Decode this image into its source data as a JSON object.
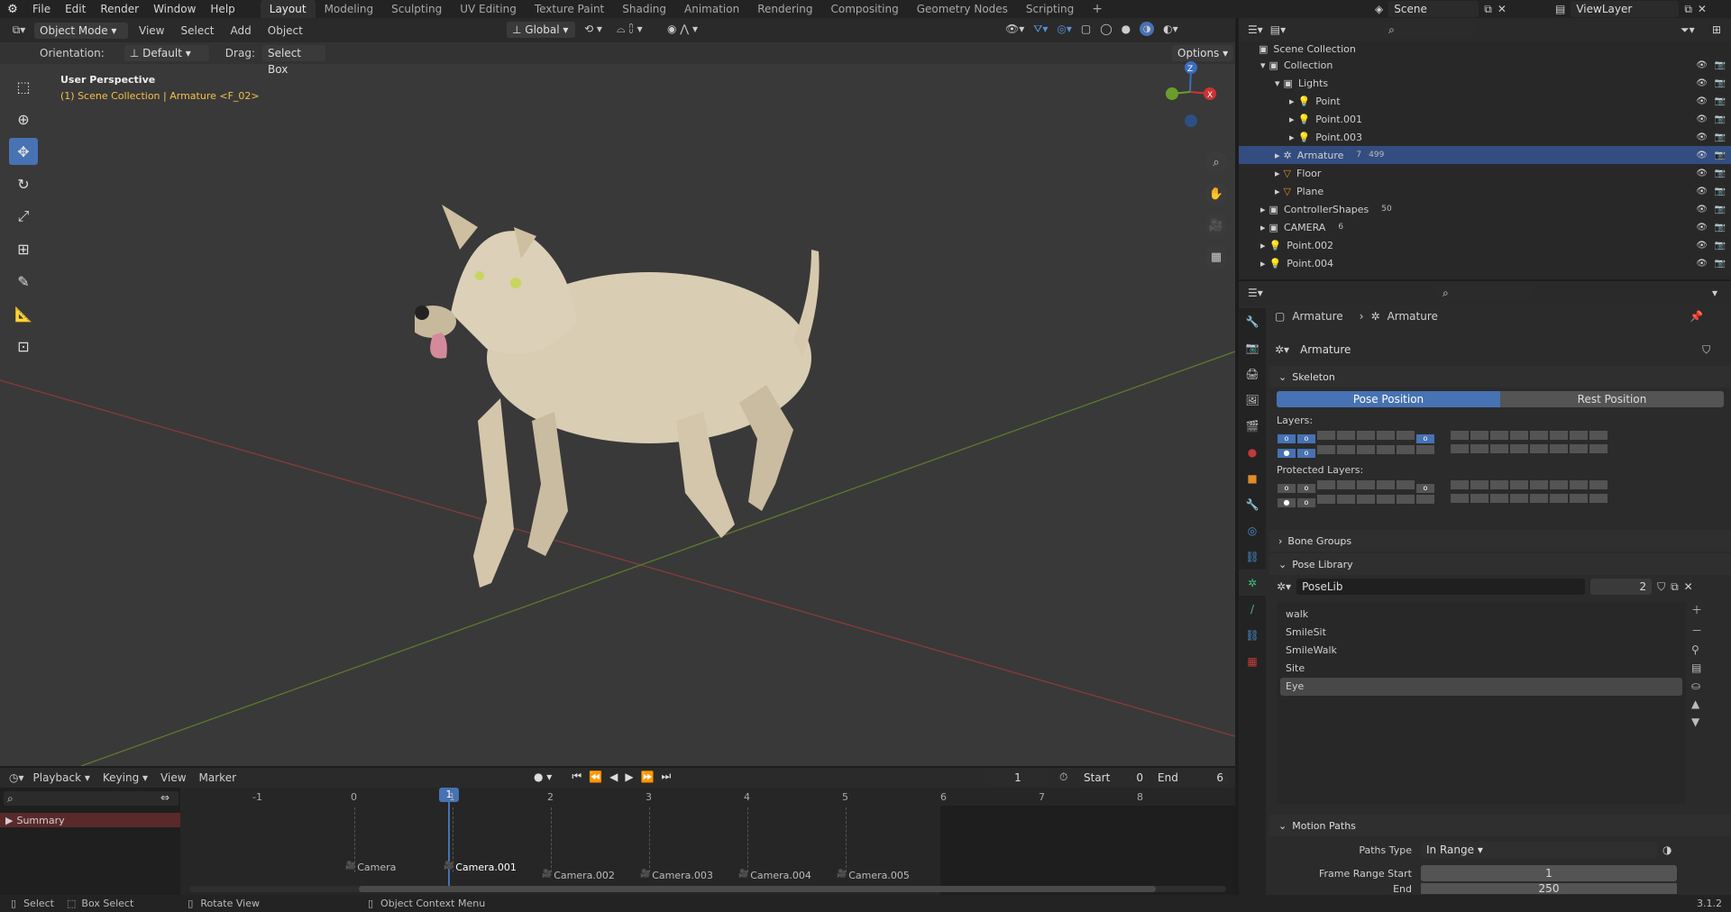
{
  "topbar": {
    "menus": [
      "File",
      "Edit",
      "Render",
      "Window",
      "Help"
    ],
    "workspaces": [
      "Layout",
      "Modeling",
      "Sculpting",
      "UV Editing",
      "Texture Paint",
      "Shading",
      "Animation",
      "Rendering",
      "Compositing",
      "Geometry Nodes",
      "Scripting"
    ],
    "active_workspace": "Layout",
    "scene": "Scene",
    "view_layer": "ViewLayer"
  },
  "viewport_header": {
    "mode": "Object Mode",
    "menus": [
      "View",
      "Select",
      "Add",
      "Object"
    ],
    "transform_orientation": "Global",
    "orientation_label": "Orientation:",
    "orientation_value": "Default",
    "drag_label": "Drag:",
    "drag_value": "Select Box",
    "options": "Options"
  },
  "viewport": {
    "view_name": "User Perspective",
    "context": "(1) Scene Collection | Armature <F_02>",
    "gizmo_axes": [
      "Z",
      "X",
      "Y"
    ]
  },
  "outliner": {
    "root": "Scene Collection",
    "rows": [
      {
        "label": "Collection",
        "depth": 1
      },
      {
        "label": "Lights",
        "depth": 2
      },
      {
        "label": "Point",
        "depth": 3
      },
      {
        "label": "Point.001",
        "depth": 3
      },
      {
        "label": "Point.003",
        "depth": 3
      },
      {
        "label": "Armature",
        "depth": 2,
        "badge": "7",
        "badge2": "499"
      },
      {
        "label": "Floor",
        "depth": 2
      },
      {
        "label": "Plane",
        "depth": 2
      },
      {
        "label": "ControllerShapes",
        "depth": 1,
        "badge": "50"
      },
      {
        "label": "CAMERA",
        "depth": 1,
        "badge": "6"
      },
      {
        "label": "Point.002",
        "depth": 1
      },
      {
        "label": "Point.004",
        "depth": 1
      }
    ]
  },
  "properties": {
    "breadcrumb_obj": "Armature",
    "breadcrumb_data": "Armature",
    "datablock": "Armature",
    "skeleton": "Skeleton",
    "pose_position": "Pose Position",
    "rest_position": "Rest Position",
    "layers": "Layers:",
    "protected_layers": "Protected Layers:",
    "bone_groups": "Bone Groups",
    "pose_library": "Pose Library",
    "poselib_name": "PoseLib",
    "poselib_users": "2",
    "poses": [
      "walk",
      "SmileSit",
      "SmileWalk",
      "Site",
      "Eye"
    ],
    "active_pose": "Eye",
    "motion_paths": "Motion Paths",
    "paths_type_label": "Paths Type",
    "paths_type_value": "In Range",
    "frame_range_start_label": "Frame Range Start",
    "frame_range_start_value": "1",
    "end_label": "End",
    "end_value": "250"
  },
  "timeline": {
    "menus": [
      "Playback",
      "Keying",
      "View",
      "Marker"
    ],
    "current_frame": "1",
    "start_label": "Start",
    "start_value": "0",
    "end_label": "End",
    "end_value": "6",
    "ruler": [
      "-1",
      "0",
      "1",
      "2",
      "3",
      "4",
      "5",
      "6",
      "7",
      "8"
    ],
    "summary": "Summary",
    "markers": [
      "Camera",
      "Camera.001",
      "Camera.002",
      "Camera.003",
      "Camera.004",
      "Camera.005"
    ]
  },
  "status": {
    "select": "Select",
    "box_select": "Box Select",
    "rotate_view": "Rotate View",
    "context_menu": "Object Context Menu",
    "version": "3.1.2"
  }
}
